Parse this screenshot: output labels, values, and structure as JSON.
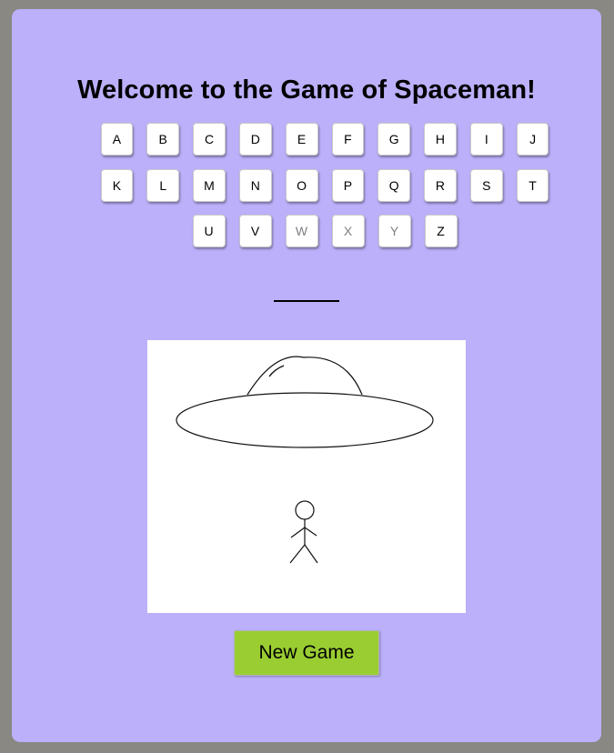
{
  "game": {
    "title": "Welcome to the Game of Spaceman!",
    "new_game_label": "New Game"
  },
  "keyboard": {
    "rows": [
      [
        {
          "letter": "A",
          "used": false
        },
        {
          "letter": "B",
          "used": false
        },
        {
          "letter": "C",
          "used": false
        },
        {
          "letter": "D",
          "used": false
        },
        {
          "letter": "E",
          "used": false
        },
        {
          "letter": "F",
          "used": false
        },
        {
          "letter": "G",
          "used": false
        },
        {
          "letter": "H",
          "used": false
        },
        {
          "letter": "I",
          "used": false
        },
        {
          "letter": "J",
          "used": false
        }
      ],
      [
        {
          "letter": "K",
          "used": false
        },
        {
          "letter": "L",
          "used": false
        },
        {
          "letter": "M",
          "used": false
        },
        {
          "letter": "N",
          "used": false
        },
        {
          "letter": "O",
          "used": false
        },
        {
          "letter": "P",
          "used": false
        },
        {
          "letter": "Q",
          "used": false
        },
        {
          "letter": "R",
          "used": false
        },
        {
          "letter": "S",
          "used": false
        },
        {
          "letter": "T",
          "used": false
        }
      ],
      [
        {
          "letter": "U",
          "used": false
        },
        {
          "letter": "V",
          "used": false
        },
        {
          "letter": "W",
          "used": true
        },
        {
          "letter": "X",
          "used": true
        },
        {
          "letter": "Y",
          "used": true
        },
        {
          "letter": "Z",
          "used": false
        }
      ]
    ]
  },
  "word": {
    "blank_count": 1
  },
  "colors": {
    "page_bg": "#898883",
    "panel_bg": "#bbb0f9",
    "new_game_bg": "#9acd32",
    "used_key_text": "#7f7f85"
  },
  "icons": {
    "scene": "ufo-abducting-stick-figure"
  }
}
